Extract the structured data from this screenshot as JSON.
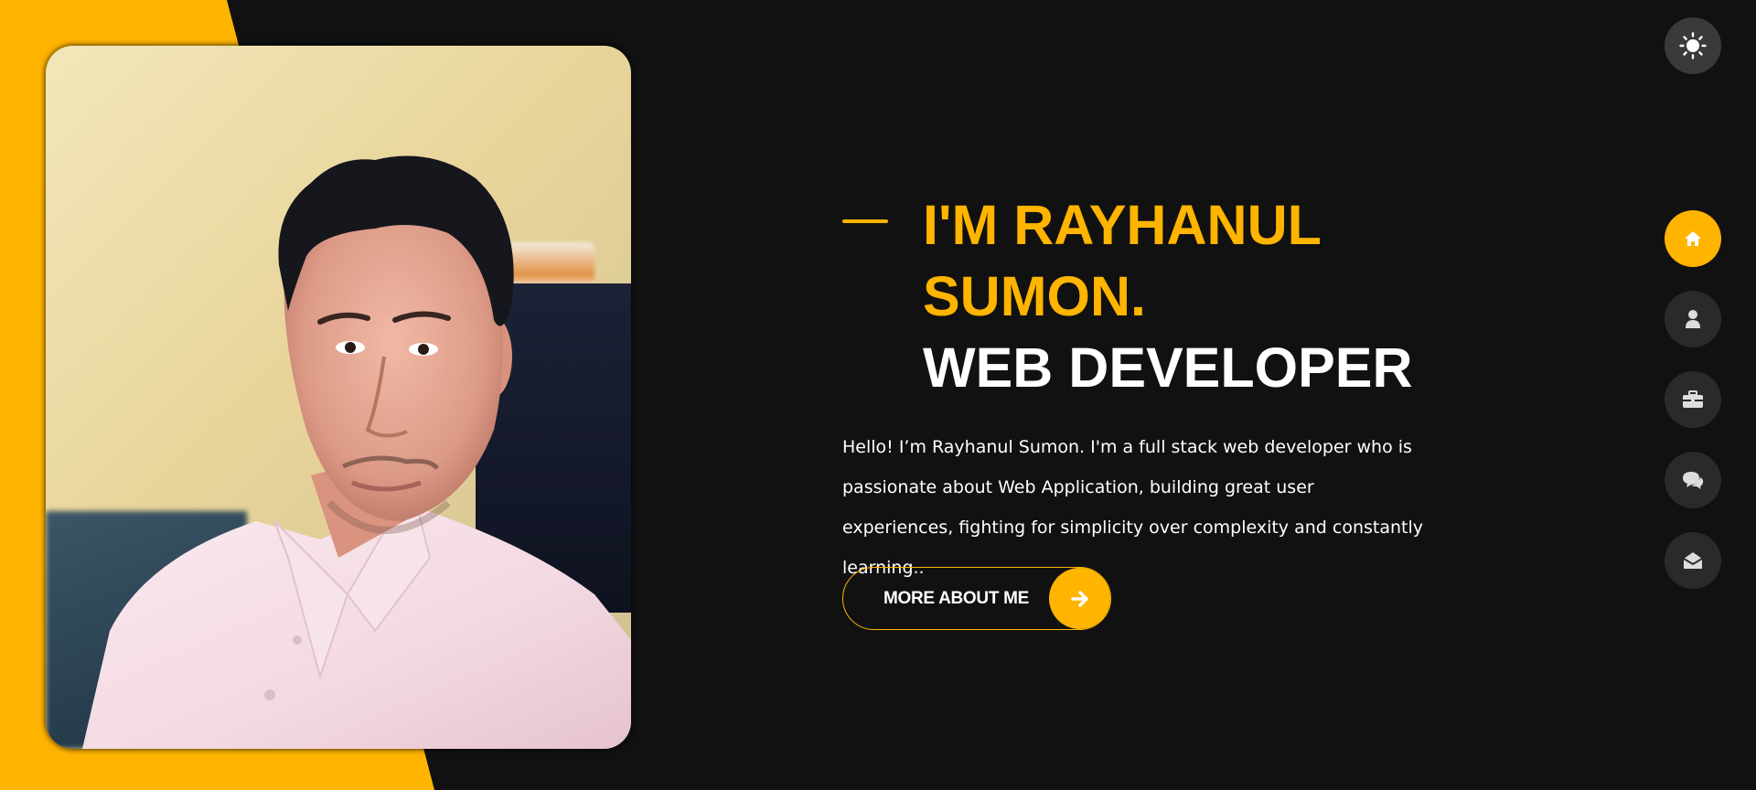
{
  "hero": {
    "name_line": "I'm Rayhanul Sumon.",
    "role_line": "Web Developer",
    "description": "Hello! I’m Rayhanul Sumon. I'm a full stack web developer who is passionate about Web Application, building great user experiences, fighting for simplicity over complexity and constantly learning..",
    "cta_label": "MORE ABOUT ME",
    "cta_icon": "arrow-right-icon"
  },
  "theme_toggle": {
    "icon": "sun-icon"
  },
  "nav": {
    "items": [
      {
        "icon": "home-icon",
        "active": true
      },
      {
        "icon": "user-icon",
        "active": false
      },
      {
        "icon": "briefcase-icon",
        "active": false
      },
      {
        "icon": "comments-icon",
        "active": false
      },
      {
        "icon": "envelope-open-icon",
        "active": false
      }
    ]
  },
  "colors": {
    "accent": "#ffb400",
    "background": "#111111",
    "nav_button": "#2b2a2a",
    "toggle_button": "#3a3a3a",
    "text": "#ffffff"
  }
}
